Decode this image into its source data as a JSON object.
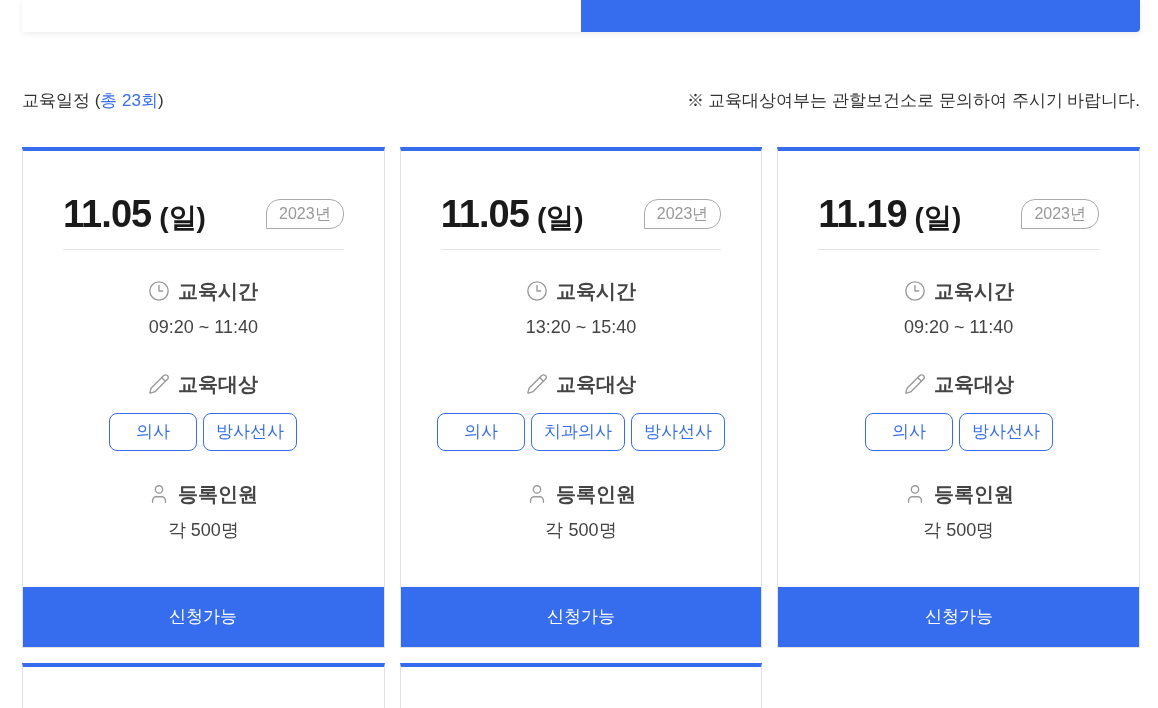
{
  "tabs": [
    {
      "selected": false
    },
    {
      "selected": true
    }
  ],
  "schedule": {
    "label": "교육일정 (",
    "total": "총 23회",
    "close": ")",
    "notice": "※ 교육대상여부는 관할보건소로 문의하여 주시기 바랍니다."
  },
  "cards": [
    {
      "kind": "full",
      "date": "11.05",
      "weekday": "(일)",
      "year": "2023년",
      "sections": [
        {
          "kind": "time",
          "title": "교육시간",
          "value": "09:20 ~ 11:40"
        },
        {
          "kind": "target",
          "title": "교육대상",
          "tags": [
            "의사",
            "방사선사"
          ]
        },
        {
          "kind": "people",
          "title": "등록인원",
          "value": "각 500명"
        }
      ],
      "button": "신청가능"
    },
    {
      "kind": "full",
      "date": "11.05",
      "weekday": "(일)",
      "year": "2023년",
      "sections": [
        {
          "kind": "time",
          "title": "교육시간",
          "value": "13:20 ~ 15:40"
        },
        {
          "kind": "target",
          "title": "교육대상",
          "tags": [
            "의사",
            "치과의사",
            "방사선사"
          ]
        },
        {
          "kind": "people",
          "title": "등록인원",
          "value": "각 500명"
        }
      ],
      "button": "신청가능"
    },
    {
      "kind": "full",
      "date": "11.19",
      "weekday": "(일)",
      "year": "2023년",
      "sections": [
        {
          "kind": "time",
          "title": "교육시간",
          "value": "09:20 ~ 11:40"
        },
        {
          "kind": "target",
          "title": "교육대상",
          "tags": [
            "의사",
            "방사선사"
          ]
        },
        {
          "kind": "people",
          "title": "등록인원",
          "value": "각 500명"
        }
      ],
      "button": "신청가능"
    },
    {
      "kind": "cut"
    },
    {
      "kind": "cut"
    }
  ]
}
